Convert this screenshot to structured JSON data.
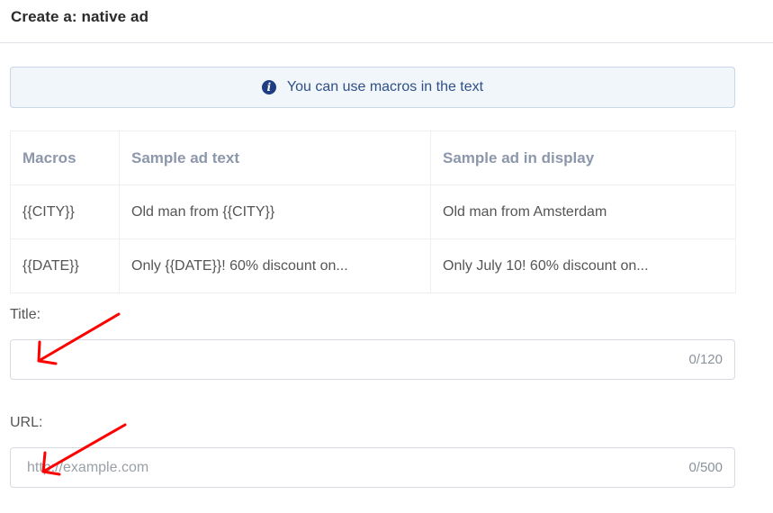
{
  "header": {
    "title": "Create a: native ad"
  },
  "info_banner": {
    "icon": "info-icon",
    "icon_glyph": "i",
    "text": "You can use macros in the text"
  },
  "macros_table": {
    "columns": [
      "Macros",
      "Sample ad text",
      "Sample ad in display"
    ],
    "rows": [
      [
        "{{CITY}}",
        "Old man from {{CITY}}",
        "Old man from Amsterdam"
      ],
      [
        "{{DATE}}",
        "Only {{DATE}}! 60% discount on...",
        "Only July 10! 60% discount on..."
      ]
    ]
  },
  "title_field": {
    "label": "Title:",
    "value": "",
    "placeholder": "",
    "counter": "0/120"
  },
  "url_field": {
    "label": "URL:",
    "value": "",
    "placeholder": "http://example.com",
    "counter": "0/500"
  },
  "colors": {
    "banner_bg": "#f1f6fb",
    "banner_text": "#2f4f86",
    "annotation_arrow": "#ff0000"
  }
}
